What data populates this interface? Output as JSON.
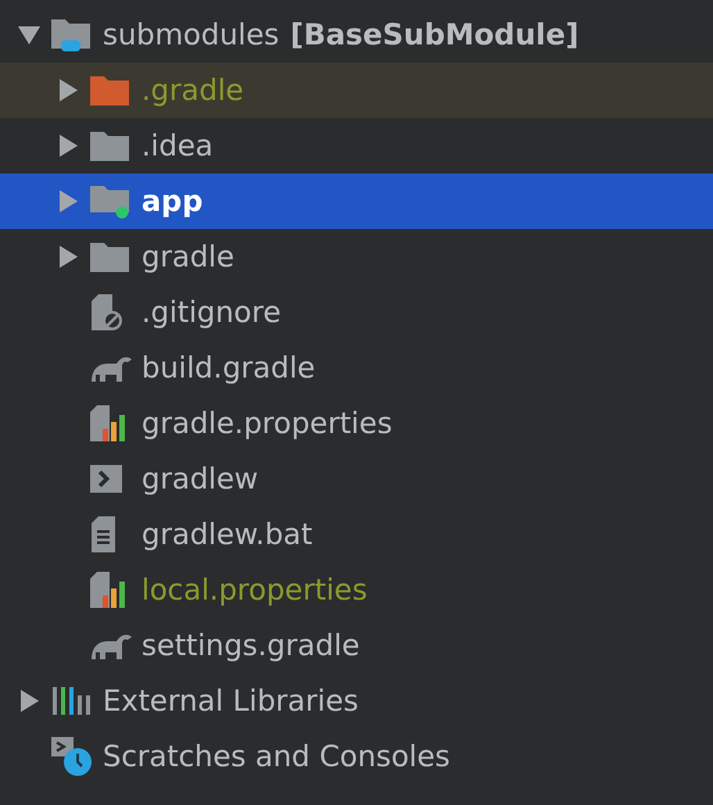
{
  "tree": [
    {
      "label": "submodules",
      "suffix": "[BaseSubModule]",
      "kind": "module",
      "expanded": true,
      "selected": false,
      "ignored": false,
      "children": [
        {
          "label": ".gradle",
          "kind": "excluded-folder",
          "expanded": false,
          "selected": false,
          "ignored": true
        },
        {
          "label": ".idea",
          "kind": "folder",
          "expanded": false,
          "selected": false,
          "ignored": false
        },
        {
          "label": "app",
          "kind": "module-folder",
          "expanded": false,
          "selected": true,
          "ignored": false
        },
        {
          "label": "gradle",
          "kind": "folder",
          "expanded": false,
          "selected": false,
          "ignored": false
        },
        {
          "label": ".gitignore",
          "kind": "gitignore",
          "selected": false,
          "ignored": false
        },
        {
          "label": "build.gradle",
          "kind": "gradle",
          "selected": false,
          "ignored": false
        },
        {
          "label": "gradle.properties",
          "kind": "properties",
          "selected": false,
          "ignored": false
        },
        {
          "label": "gradlew",
          "kind": "script",
          "selected": false,
          "ignored": false
        },
        {
          "label": "gradlew.bat",
          "kind": "text",
          "selected": false,
          "ignored": false
        },
        {
          "label": "local.properties",
          "kind": "properties",
          "selected": false,
          "ignored": true
        },
        {
          "label": "settings.gradle",
          "kind": "gradle",
          "selected": false,
          "ignored": false
        }
      ]
    },
    {
      "label": "External Libraries",
      "kind": "libraries",
      "expanded": false,
      "selected": false,
      "ignored": false
    },
    {
      "label": "Scratches and Consoles",
      "kind": "scratches",
      "selected": false,
      "ignored": false
    }
  ]
}
